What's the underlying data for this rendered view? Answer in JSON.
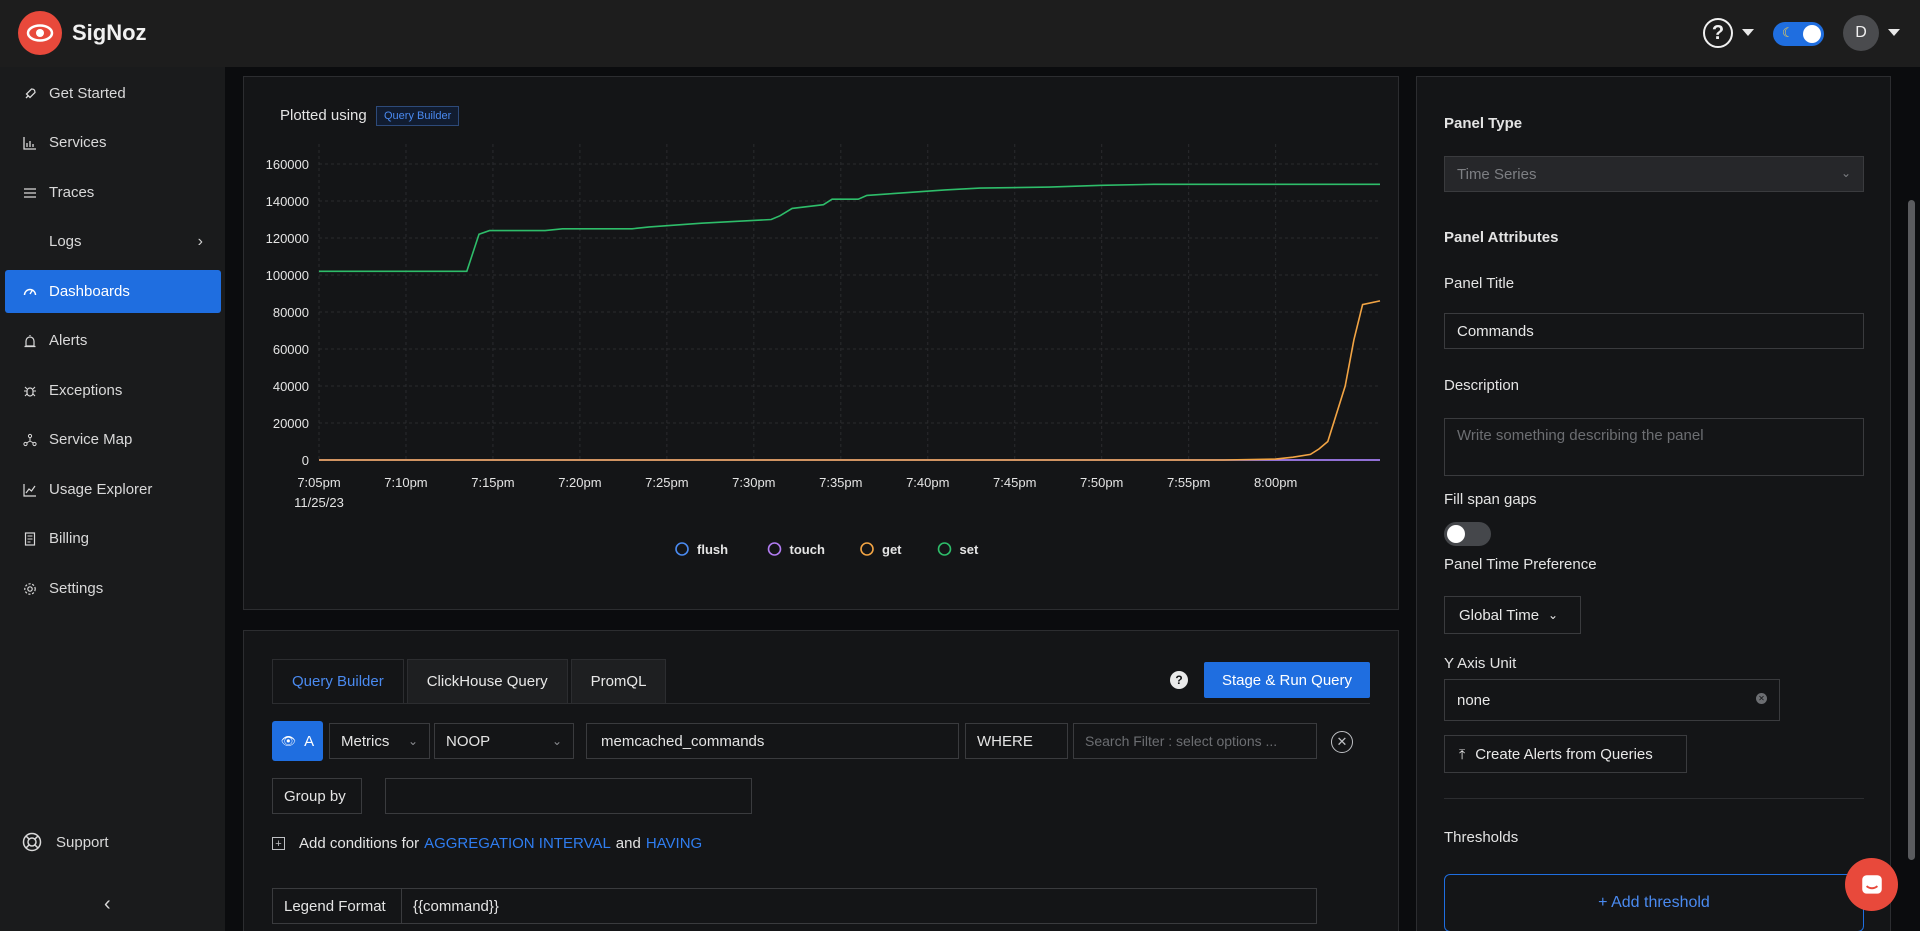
{
  "app": {
    "brand": "SigNoz",
    "avatar_initial": "D",
    "theme_icon": "moon-icon"
  },
  "colors": {
    "primary": "#1f6ee0",
    "logo": "#e8493b",
    "flush": "#4a8af0",
    "touch": "#b27cf2",
    "get": "#f2a444",
    "set": "#2ebd6a"
  },
  "sidebar": {
    "items": [
      {
        "label": "Get Started",
        "icon": "rocket-icon"
      },
      {
        "label": "Services",
        "icon": "bar-chart-icon"
      },
      {
        "label": "Traces",
        "icon": "menu-lines-icon"
      },
      {
        "label": "Logs",
        "icon": "logs-icon"
      },
      {
        "label": "Dashboards",
        "icon": "dashboard-icon"
      },
      {
        "label": "Alerts",
        "icon": "alarm-icon"
      },
      {
        "label": "Exceptions",
        "icon": "bug-icon"
      },
      {
        "label": "Service Map",
        "icon": "network-icon"
      },
      {
        "label": "Usage Explorer",
        "icon": "line-chart-icon"
      },
      {
        "label": "Billing",
        "icon": "billing-icon"
      },
      {
        "label": "Settings",
        "icon": "gear-icon"
      }
    ],
    "active_index": 4,
    "support_label": "Support"
  },
  "chart_card": {
    "plotted_label": "Plotted using",
    "source_chip": "Query Builder"
  },
  "chart_data": {
    "type": "line",
    "x_ticks": [
      "7:05pm",
      "7:10pm",
      "7:15pm",
      "7:20pm",
      "7:25pm",
      "7:30pm",
      "7:35pm",
      "7:40pm",
      "7:45pm",
      "7:50pm",
      "7:55pm",
      "8:00pm"
    ],
    "x_date_label": "11/25/23",
    "y_ticks": [
      0,
      20000,
      40000,
      60000,
      80000,
      100000,
      120000,
      140000,
      160000
    ],
    "ylim": [
      0,
      160000
    ],
    "x_range_minutes": [
      0,
      61
    ],
    "grid": true,
    "legend_position": "bottom",
    "series": [
      {
        "name": "flush",
        "points": [
          [
            0,
            0
          ],
          [
            61,
            0
          ]
        ]
      },
      {
        "name": "touch",
        "points": [
          [
            0,
            0
          ],
          [
            61,
            0
          ]
        ]
      },
      {
        "name": "get",
        "points": [
          [
            0,
            0
          ],
          [
            52,
            0
          ],
          [
            55,
            500
          ],
          [
            56,
            1500
          ],
          [
            57,
            3000
          ],
          [
            57.5,
            6000
          ],
          [
            58,
            10000
          ],
          [
            59,
            40000
          ],
          [
            59.5,
            65000
          ],
          [
            60,
            84000
          ],
          [
            61,
            86000
          ]
        ]
      },
      {
        "name": "set",
        "points": [
          [
            0,
            102000
          ],
          [
            8.5,
            102000
          ],
          [
            9.2,
            122000
          ],
          [
            9.8,
            124000
          ],
          [
            13,
            124000
          ],
          [
            14,
            125000
          ],
          [
            18,
            125000
          ],
          [
            19,
            126000
          ],
          [
            22,
            128000
          ],
          [
            26,
            130000
          ],
          [
            26.5,
            132000
          ],
          [
            27.2,
            136000
          ],
          [
            29,
            138000
          ],
          [
            29.5,
            141000
          ],
          [
            31,
            141000
          ],
          [
            31.5,
            143000
          ],
          [
            33,
            144000
          ],
          [
            36,
            146000
          ],
          [
            38,
            147000
          ],
          [
            42,
            147500
          ],
          [
            45,
            148500
          ],
          [
            48,
            149000
          ],
          [
            61,
            149000
          ]
        ]
      }
    ]
  },
  "query": {
    "tabs": [
      "Query Builder",
      "ClickHouse Query",
      "PromQL"
    ],
    "active_tab": 0,
    "run_label": "Stage & Run Query",
    "query_letter": "A",
    "data_source": "Metrics",
    "aggregate": "NOOP",
    "metric": "memcached_commands",
    "where_label": "WHERE",
    "filter_placeholder": "Search Filter : select options ...",
    "group_by_label": "Group by",
    "cond_prefix": "Add conditions for",
    "cond_link1": "AGGREGATION INTERVAL",
    "cond_and": "and",
    "cond_link2": "HAVING",
    "legend_format_label": "Legend Format",
    "legend_format_value": "{{command}}"
  },
  "panel": {
    "type_label": "Panel Type",
    "type_value": "Time Series",
    "attributes_label": "Panel Attributes",
    "title_label": "Panel Title",
    "title_value": "Commands",
    "description_label": "Description",
    "description_placeholder": "Write something describing the  panel",
    "fill_span_label": "Fill span gaps",
    "time_pref_label": "Panel Time Preference",
    "time_pref_value": "Global Time",
    "y_unit_label": "Y Axis Unit",
    "y_unit_value": "none",
    "create_alerts_label": "Create Alerts from Queries",
    "thresholds_label": "Thresholds",
    "add_threshold_label": "+ Add threshold"
  }
}
